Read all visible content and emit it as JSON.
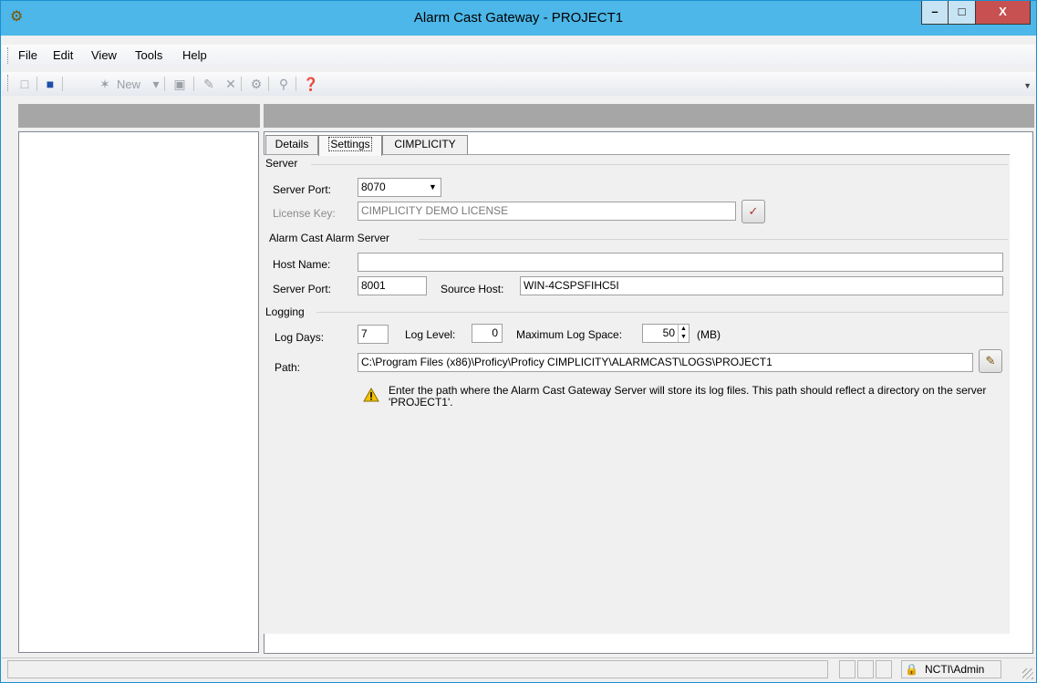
{
  "window": {
    "title": "Alarm Cast Gateway - PROJECT1",
    "min": "–",
    "max": "□",
    "close": "X",
    "icon": "app-gear-icon"
  },
  "menu": [
    "File",
    "Edit",
    "View",
    "Tools",
    "Help"
  ],
  "toolbar": {
    "new_label": "New"
  },
  "tabs": [
    "Details",
    "Settings",
    "CIMPLICITY"
  ],
  "server": {
    "group": "Server",
    "port_label": "Server Port:",
    "port_value": "8070",
    "license_label": "License Key:",
    "license_value": "CIMPLICITY DEMO LICENSE"
  },
  "alarm_server": {
    "group": "Alarm Cast Alarm Server",
    "host_label": "Host Name:",
    "host_value": "",
    "port_label": "Server Port:",
    "port_value": "8001",
    "source_label": "Source Host:",
    "source_value": "WIN-4CSPSFIHC5I"
  },
  "logging": {
    "group": "Logging",
    "days_label": "Log Days:",
    "days_value": "7",
    "level_label": "Log Level:",
    "level_value": "0",
    "space_label": "Maximum Log Space:",
    "space_value": "50",
    "space_unit": "(MB)",
    "path_label": "Path:",
    "path_value": "C:\\Program Files (x86)\\Proficy\\Proficy CIMPLICITY\\ALARMCAST\\LOGS\\PROJECT1",
    "warning": "Enter the path where the Alarm Cast Gateway Server will store its log files. This path should reflect a directory on the server 'PROJECT1'."
  },
  "status": {
    "user": "NCTI\\Admin"
  }
}
